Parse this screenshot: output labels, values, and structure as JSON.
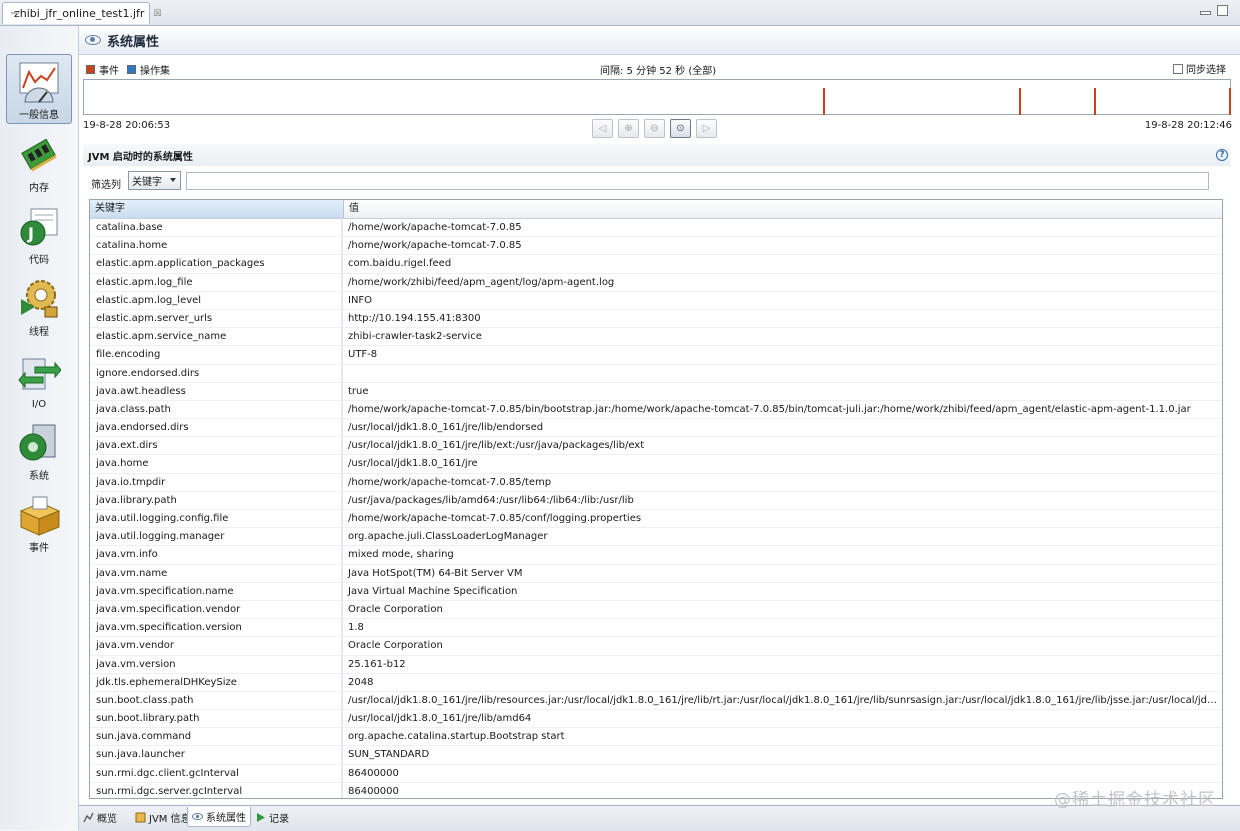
{
  "editor_tab": {
    "title": "zhibi_jfr_online_test1.jfr",
    "close": "☒"
  },
  "sidebar": {
    "items": [
      {
        "label": "一般信息"
      },
      {
        "label": "内存"
      },
      {
        "label": "代码"
      },
      {
        "label": "线程"
      },
      {
        "label": "I/O"
      },
      {
        "label": "系统"
      },
      {
        "label": "事件"
      }
    ]
  },
  "page": {
    "title": "系统属性"
  },
  "timeline": {
    "legend": [
      {
        "label": "事件",
        "color": "#c8431b"
      },
      {
        "label": "操作集",
        "color": "#2f78c4"
      }
    ],
    "interval": "间隔: 5 分钟 52 秒 (全部)",
    "sync_label": "同步选择",
    "start": "19-8-28 20:06:53",
    "end": "19-8-28 20:12:46",
    "event_fractions": [
      0.645,
      0.816,
      0.881,
      0.999
    ]
  },
  "section": {
    "title": "JVM 启动时的系统属性",
    "help": "?"
  },
  "filter": {
    "label": "筛选列",
    "selected": "关键字",
    "value": ""
  },
  "table": {
    "columns": [
      "关键字",
      "值"
    ],
    "rows": [
      [
        "catalina.base",
        "/home/work/apache-tomcat-7.0.85"
      ],
      [
        "catalina.home",
        "/home/work/apache-tomcat-7.0.85"
      ],
      [
        "elastic.apm.application_packages",
        "com.baidu.rigel.feed"
      ],
      [
        "elastic.apm.log_file",
        "/home/work/zhibi/feed/apm_agent/log/apm-agent.log"
      ],
      [
        "elastic.apm.log_level",
        "INFO"
      ],
      [
        "elastic.apm.server_urls",
        "http://10.194.155.41:8300"
      ],
      [
        "elastic.apm.service_name",
        "zhibi-crawler-task2-service"
      ],
      [
        "file.encoding",
        "UTF-8"
      ],
      [
        "ignore.endorsed.dirs",
        ""
      ],
      [
        "java.awt.headless",
        "true"
      ],
      [
        "java.class.path",
        "/home/work/apache-tomcat-7.0.85/bin/bootstrap.jar:/home/work/apache-tomcat-7.0.85/bin/tomcat-juli.jar:/home/work/zhibi/feed/apm_agent/elastic-apm-agent-1.1.0.jar"
      ],
      [
        "java.endorsed.dirs",
        "/usr/local/jdk1.8.0_161/jre/lib/endorsed"
      ],
      [
        "java.ext.dirs",
        "/usr/local/jdk1.8.0_161/jre/lib/ext:/usr/java/packages/lib/ext"
      ],
      [
        "java.home",
        "/usr/local/jdk1.8.0_161/jre"
      ],
      [
        "java.io.tmpdir",
        "/home/work/apache-tomcat-7.0.85/temp"
      ],
      [
        "java.library.path",
        "/usr/java/packages/lib/amd64:/usr/lib64:/lib64:/lib:/usr/lib"
      ],
      [
        "java.util.logging.config.file",
        "/home/work/apache-tomcat-7.0.85/conf/logging.properties"
      ],
      [
        "java.util.logging.manager",
        "org.apache.juli.ClassLoaderLogManager"
      ],
      [
        "java.vm.info",
        "mixed mode, sharing"
      ],
      [
        "java.vm.name",
        "Java HotSpot(TM) 64-Bit Server VM"
      ],
      [
        "java.vm.specification.name",
        "Java Virtual Machine Specification"
      ],
      [
        "java.vm.specification.vendor",
        "Oracle Corporation"
      ],
      [
        "java.vm.specification.version",
        "1.8"
      ],
      [
        "java.vm.vendor",
        "Oracle Corporation"
      ],
      [
        "java.vm.version",
        "25.161-b12"
      ],
      [
        "jdk.tls.ephemeralDHKeySize",
        "2048"
      ],
      [
        "sun.boot.class.path",
        "/usr/local/jdk1.8.0_161/jre/lib/resources.jar:/usr/local/jdk1.8.0_161/jre/lib/rt.jar:/usr/local/jdk1.8.0_161/jre/lib/sunrsasign.jar:/usr/local/jdk1.8.0_161/jre/lib/jsse.jar:/usr/local/jdk1.8.0_..."
      ],
      [
        "sun.boot.library.path",
        "/usr/local/jdk1.8.0_161/jre/lib/amd64"
      ],
      [
        "sun.java.command",
        "org.apache.catalina.startup.Bootstrap start"
      ],
      [
        "sun.java.launcher",
        "SUN_STANDARD"
      ],
      [
        "sun.rmi.dgc.client.gcInterval",
        "86400000"
      ],
      [
        "sun.rmi.dgc.server.gcInterval",
        "86400000"
      ]
    ]
  },
  "bottom_tabs": [
    {
      "label": "概览"
    },
    {
      "label": "JVM 信息"
    },
    {
      "label": "系统属性",
      "active": true
    },
    {
      "label": "记录"
    }
  ],
  "watermark": "@稀土掘金技术社区"
}
